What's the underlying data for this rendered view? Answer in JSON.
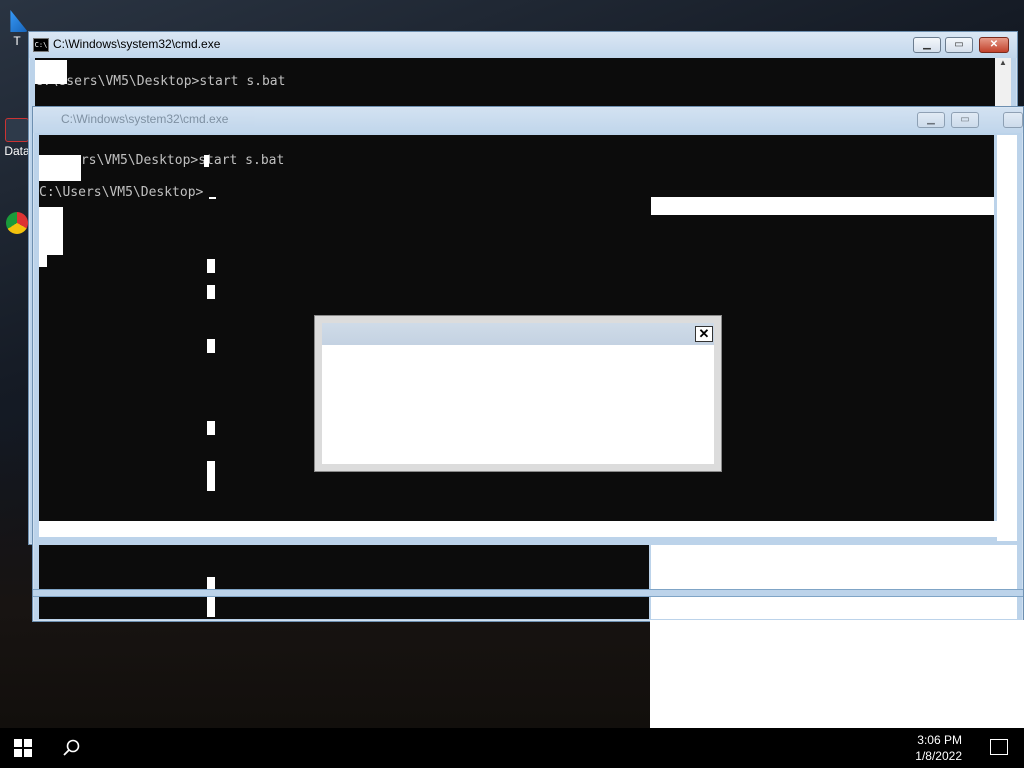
{
  "desktop": {
    "icons": [
      {
        "label": "T",
        "icon": "recycle-bin-icon"
      },
      {
        "label": "Data",
        "icon": "data-shortcut-icon"
      },
      {
        "label": "",
        "icon": "chrome-icon"
      }
    ]
  },
  "back_window": {
    "title": "C:\\Windows\\system32\\cmd.exe",
    "lines": [
      "C:\\Users\\VM5\\Desktop>start s.bat"
    ]
  },
  "front_window": {
    "title": "C:\\Windows\\system32\\cmd.exe",
    "lines": [
      "ers\\VM5\\Desktop>start s.bat",
      "C:\\Users\\VM5\\Desktop>"
    ]
  },
  "dialog": {
    "close_label": "✕"
  },
  "taskbar": {
    "time": "3:06 PM",
    "date": "1/8/2022"
  }
}
